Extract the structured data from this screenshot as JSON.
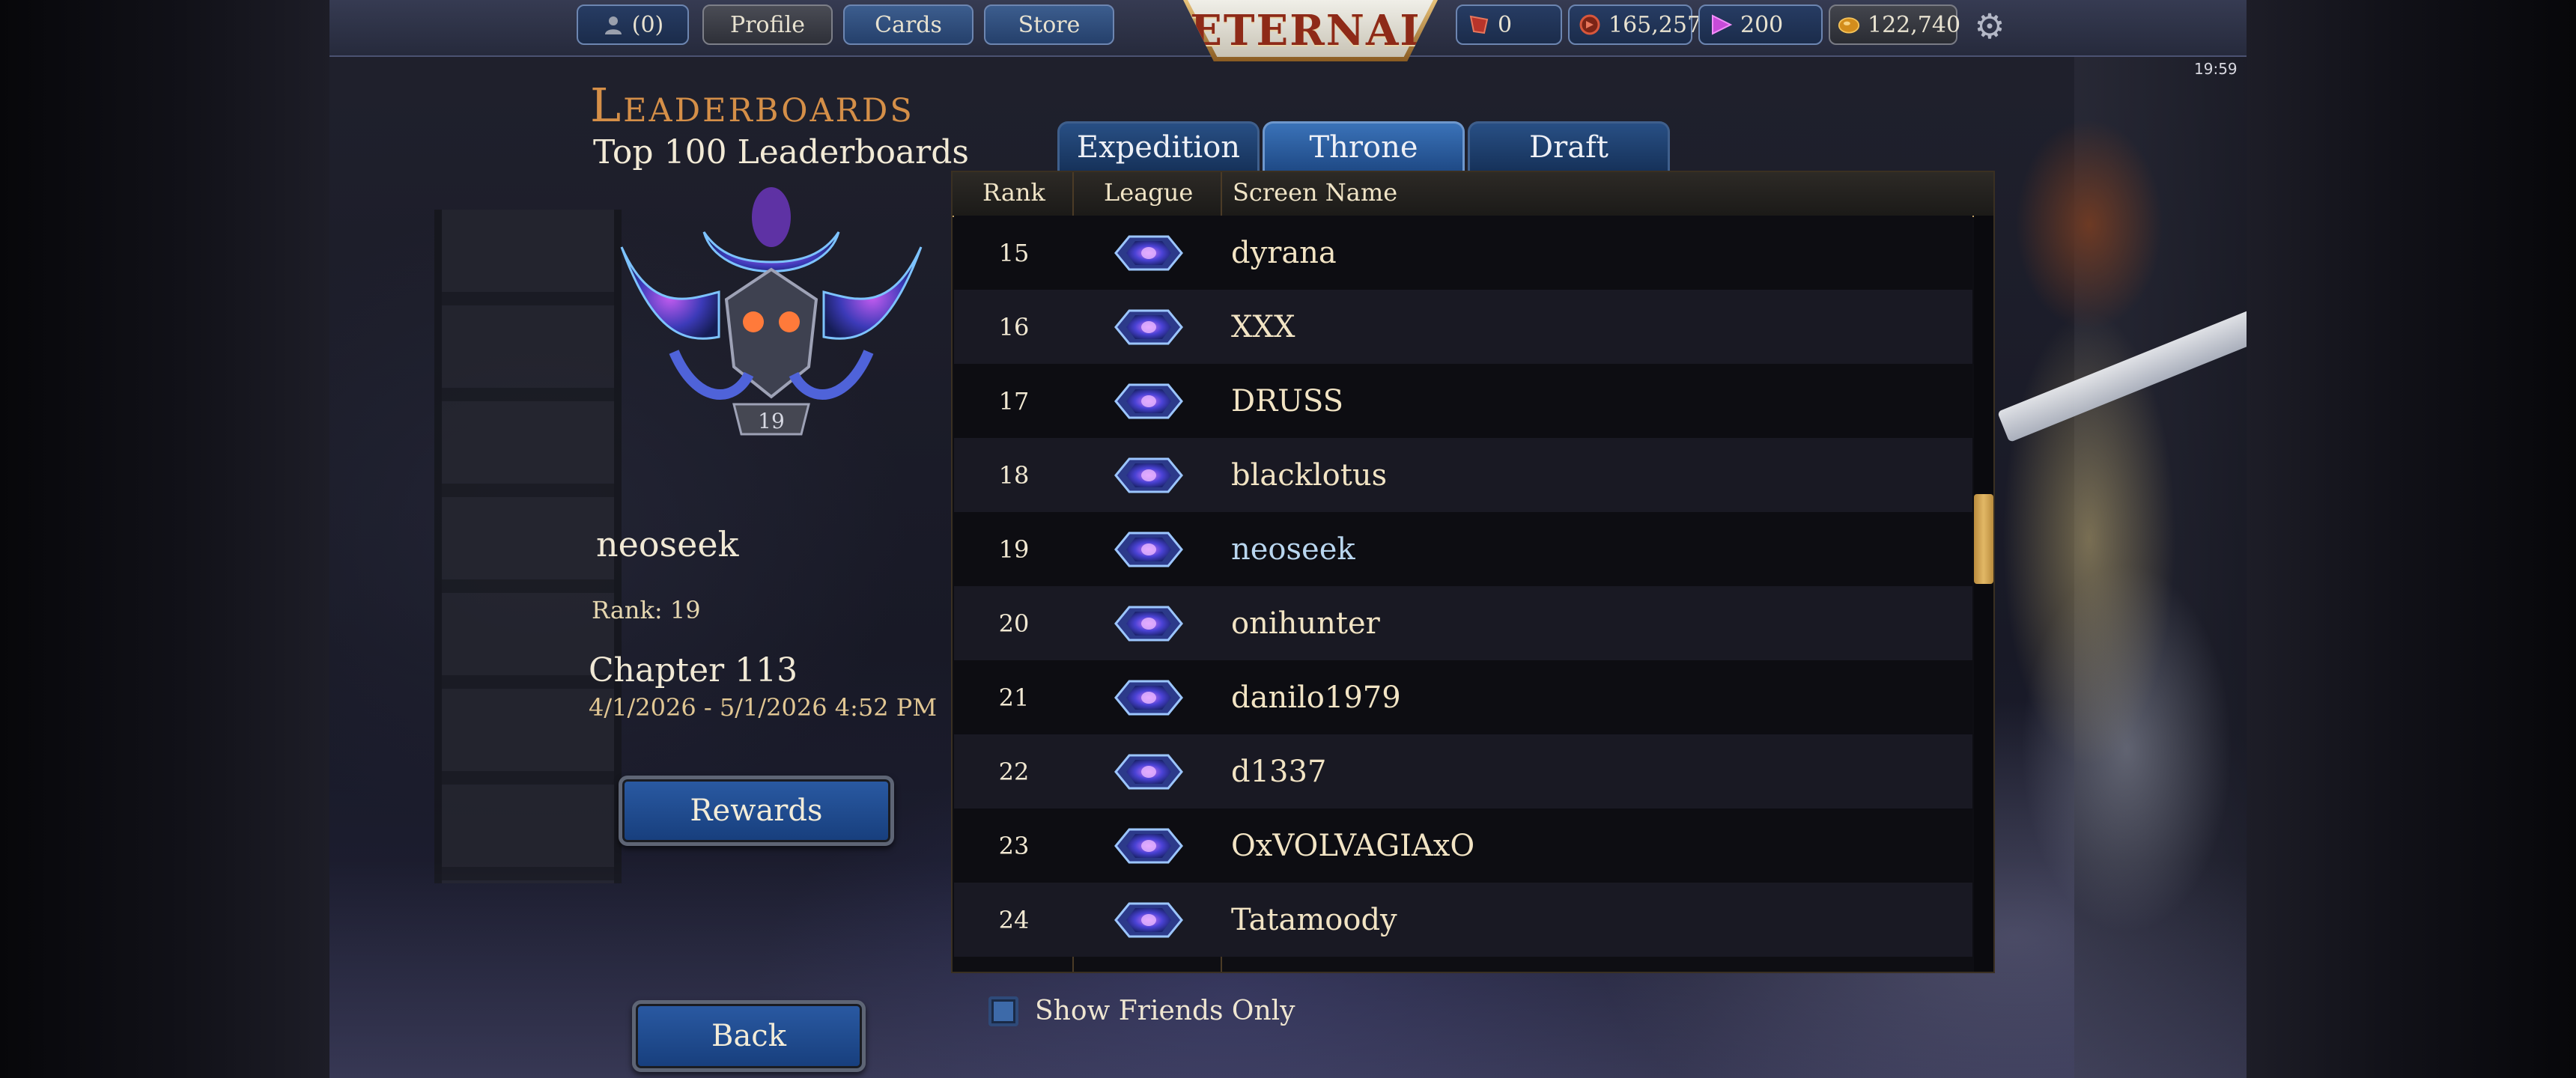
{
  "topbar": {
    "friends_count": "(0)",
    "profile_label": "Profile",
    "cards_label": "Cards",
    "store_label": "Store",
    "logo_text": "ETERNAL",
    "shiftstone": "0",
    "gold": "165,257",
    "gems": "200",
    "shards": "122,740",
    "clock": "19:59"
  },
  "panel": {
    "title": "Leaderboards",
    "subtitle": "Top 100 Leaderboards",
    "emblem_rank": "19",
    "player_name": "neoseek",
    "rank_text": "Rank: 19",
    "chapter": "Chapter 113",
    "dates": "4/1/2026 - 5/1/2026 4:52 PM",
    "rewards_label": "Rewards",
    "back_label": "Back"
  },
  "tabs": [
    "Expedition",
    "Throne",
    "Draft"
  ],
  "active_tab": "Throne",
  "table": {
    "headers": [
      "Rank",
      "League",
      "Screen Name"
    ],
    "rows": [
      {
        "rank": "15",
        "name": "dyrana"
      },
      {
        "rank": "16",
        "name": "XXX"
      },
      {
        "rank": "17",
        "name": "DRUSS"
      },
      {
        "rank": "18",
        "name": "blacklotus"
      },
      {
        "rank": "19",
        "name": "neoseek"
      },
      {
        "rank": "20",
        "name": "onihunter"
      },
      {
        "rank": "21",
        "name": "danilo1979"
      },
      {
        "rank": "22",
        "name": "d1337"
      },
      {
        "rank": "23",
        "name": "OxVOLVAGIAxO"
      },
      {
        "rank": "24",
        "name": "Tatamoody"
      }
    ]
  },
  "show_friends_label": "Show Friends Only",
  "colors": {
    "accent_orange": "#d58f48",
    "button_blue": "#2a5aa3",
    "highlight_name": "#b9d6ef"
  }
}
